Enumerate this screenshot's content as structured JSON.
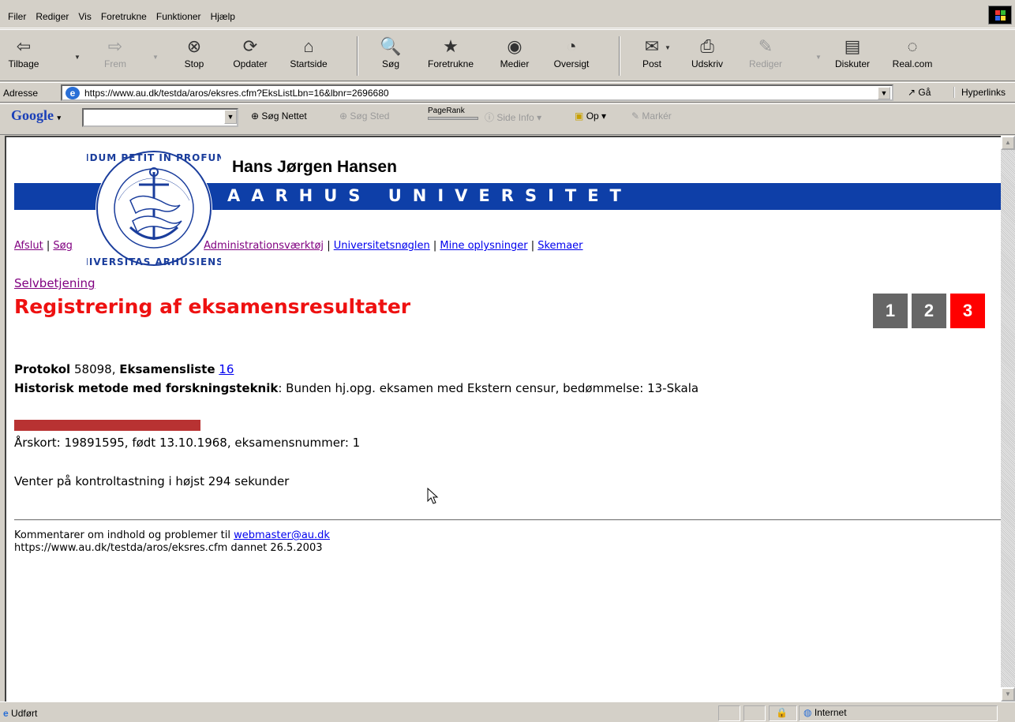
{
  "menu": [
    "Filer",
    "Rediger",
    "Vis",
    "Foretrukne",
    "Funktioner",
    "Hjælp"
  ],
  "toolbar": {
    "back": "Tilbage",
    "forward": "Frem",
    "stop": "Stop",
    "refresh": "Opdater",
    "home": "Startside",
    "search": "Søg",
    "favorites": "Foretrukne",
    "media": "Medier",
    "history": "Oversigt",
    "mail": "Post",
    "print": "Udskriv",
    "edit": "Rediger",
    "discuss": "Diskuter",
    "real": "Real.com"
  },
  "address": {
    "label": "Adresse",
    "url": "https://www.au.dk/testda/aros/eksres.cfm?EksListLbn=16&lbnr=2696680",
    "go": "Gå",
    "links": "Hyperlinks"
  },
  "google": {
    "logo": "Google",
    "search_web": "Søg Nettet",
    "search_site": "Søg Sted",
    "pagerank": "PageRank",
    "page_info": "Side Info",
    "up": "Op",
    "highlight": "Markér"
  },
  "page": {
    "owner_name": "Hans Jørgen Hansen",
    "university": "AARHUS UNIVERSITET",
    "nav": {
      "logout": "Afslut",
      "search": "Søg",
      "admin": "Administrationsværktøj",
      "key": "Universitetsnøglen",
      "myinfo": "Mine oplysninger",
      "forms": "Skemaer"
    },
    "breadcrumb": "Selvbetjening",
    "title": "Registrering af eksamensresultater",
    "steps": [
      "1",
      "2",
      "3"
    ],
    "protocol_label": "Protokol",
    "protocol_no": "58098,",
    "list_label": "Eksamensliste",
    "list_no": "16",
    "course_name": "Historisk metode med forskningsteknik",
    "course_desc": ": Bunden hj.opg. eksamen med Ekstern censur, bedømmelse: 13-Skala",
    "student_info": "Årskort: 19891595, født 13.10.1968, eksamensnummer: 1",
    "wait_text": "Venter på kontroltastning i højst 294 sekunder",
    "footer_prefix": "Kommentarer om indhold og problemer til",
    "footer_email": "webmaster@au.dk",
    "footer_line2": "https://www.au.dk/testda/aros/eksres.cfm dannet 26.5.2003"
  },
  "status": {
    "text": "Udført",
    "zone": "Internet"
  },
  "colors": {
    "title_red": "#ee1111",
    "banner_blue": "#0e3fa8",
    "step_active": "#ff0000",
    "step_done": "#666666"
  }
}
